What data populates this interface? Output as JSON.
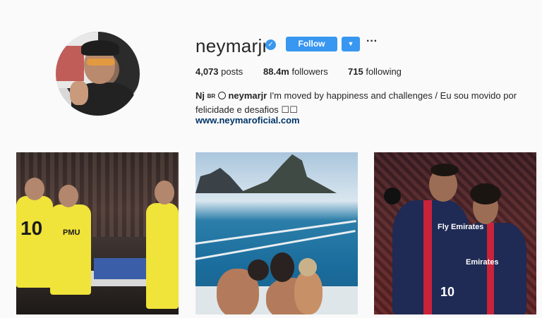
{
  "profile": {
    "username": "neymarjr",
    "verified_mark": "✓",
    "follow_label": "Follow",
    "suggest_label": "▼",
    "more_label": "···",
    "stats": {
      "posts_count": "4,073",
      "posts_label": "posts",
      "followers_count": "88.4m",
      "followers_label": "followers",
      "following_count": "715",
      "following_label": "following"
    },
    "bio": {
      "name": "Nj",
      "flag": "BR",
      "mention": "neymarjr",
      "text_line1": " I'm moved by happiness and challenges / Eu sou movido por",
      "text_line2": "felicidade e desafios ☐☐"
    },
    "website": "www.neymaroficial.com"
  },
  "posts": [
    {
      "id": "post-1",
      "number_left": "10",
      "sponsor_text": "PMU"
    },
    {
      "id": "post-2"
    },
    {
      "id": "post-3",
      "sponsor_text": "Fly Emirates",
      "number": "10",
      "sponsor_text_2": "Emirates"
    }
  ],
  "colors": {
    "accent": "#3897f0",
    "link": "#003569",
    "background": "#fafafa",
    "text": "#262626"
  },
  "icons": {
    "verified": "verified-badge-icon",
    "suggest": "chevron-down-icon",
    "more": "more-options-icon",
    "bio_link_mention": "globe-icon"
  }
}
